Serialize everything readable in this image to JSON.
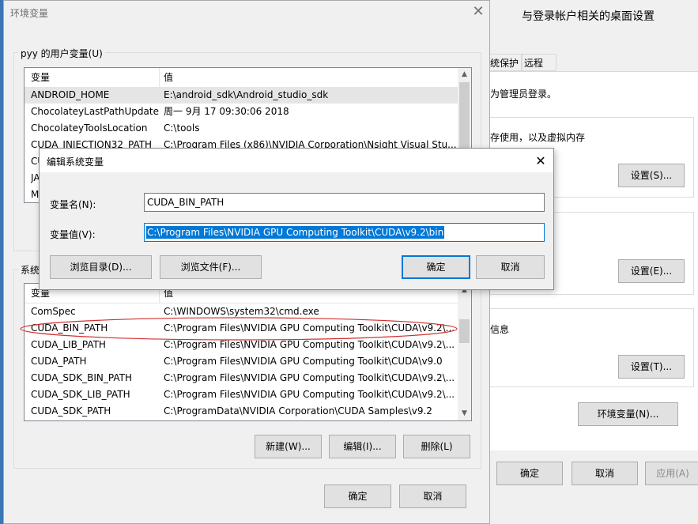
{
  "back_window": {
    "title": "与登录帐户相关的桌面设置",
    "tabs": [
      "统保护",
      "远程"
    ],
    "admin_note": "为管理员登录。",
    "perf_note": "存使用，以及虚拟内存",
    "info_note": "信息",
    "settings_s": "设置(S)...",
    "settings_e": "设置(E)...",
    "settings_t": "设置(T)...",
    "env_vars": "环境变量(N)...",
    "ok": "确定",
    "cancel": "取消",
    "apply": "应用(A)"
  },
  "env_dialog": {
    "title": "环境变量",
    "user_group": "pyy 的用户变量(U)",
    "system_group": "系统",
    "col_var": "变量",
    "col_val": "值",
    "user_vars": [
      {
        "name": "ANDROID_HOME",
        "value": "E:\\android_sdk\\Android_studio_sdk"
      },
      {
        "name": "ChocolateyLastPathUpdate",
        "value": "周一 9月 17 09:30:06 2018"
      },
      {
        "name": "ChocolateyToolsLocation",
        "value": "C:\\tools"
      },
      {
        "name": "CUDA_INJECTION32_PATH",
        "value": "C:\\Program Files (x86)\\NVIDIA Corporation\\Nsight Visual Stu..."
      },
      {
        "name": "CU",
        "value": ""
      },
      {
        "name": "JA",
        "value": ""
      },
      {
        "name": "M",
        "value": ""
      }
    ],
    "system_vars": [
      {
        "name": "ComSpec",
        "value": "C:\\WINDOWS\\system32\\cmd.exe"
      },
      {
        "name": "CUDA_BIN_PATH",
        "value": "C:\\Program Files\\NVIDIA GPU Computing Toolkit\\CUDA\\v9.2\\..."
      },
      {
        "name": "CUDA_LIB_PATH",
        "value": "C:\\Program Files\\NVIDIA GPU Computing Toolkit\\CUDA\\v9.2\\..."
      },
      {
        "name": "CUDA_PATH",
        "value": "C:\\Program Files\\NVIDIA GPU Computing Toolkit\\CUDA\\v9.0"
      },
      {
        "name": "CUDA_SDK_BIN_PATH",
        "value": "C:\\Program Files\\NVIDIA GPU Computing Toolkit\\CUDA\\v9.2\\..."
      },
      {
        "name": "CUDA_SDK_LIB_PATH",
        "value": "C:\\Program Files\\NVIDIA GPU Computing Toolkit\\CUDA\\v9.2\\..."
      },
      {
        "name": "CUDA_SDK_PATH",
        "value": "C:\\ProgramData\\NVIDIA Corporation\\CUDA Samples\\v9.2"
      }
    ],
    "new_btn": "新建(W)...",
    "edit_btn": "编辑(I)...",
    "delete_btn": "删除(L)",
    "ok": "确定",
    "cancel": "取消",
    "close_icon": "close-icon",
    "highlight_color": "#d03030"
  },
  "edit_dialog": {
    "title": "编辑系统变量",
    "name_label": "变量名(N):",
    "name_value": "CUDA_BIN_PATH",
    "value_label": "变量值(V):",
    "value_value": "C:\\Program Files\\NVIDIA GPU Computing Toolkit\\CUDA\\v9.2\\bin",
    "browse_dir": "浏览目录(D)...",
    "browse_file": "浏览文件(F)...",
    "ok": "确定",
    "cancel": "取消",
    "selection_color": "#0078d7"
  }
}
